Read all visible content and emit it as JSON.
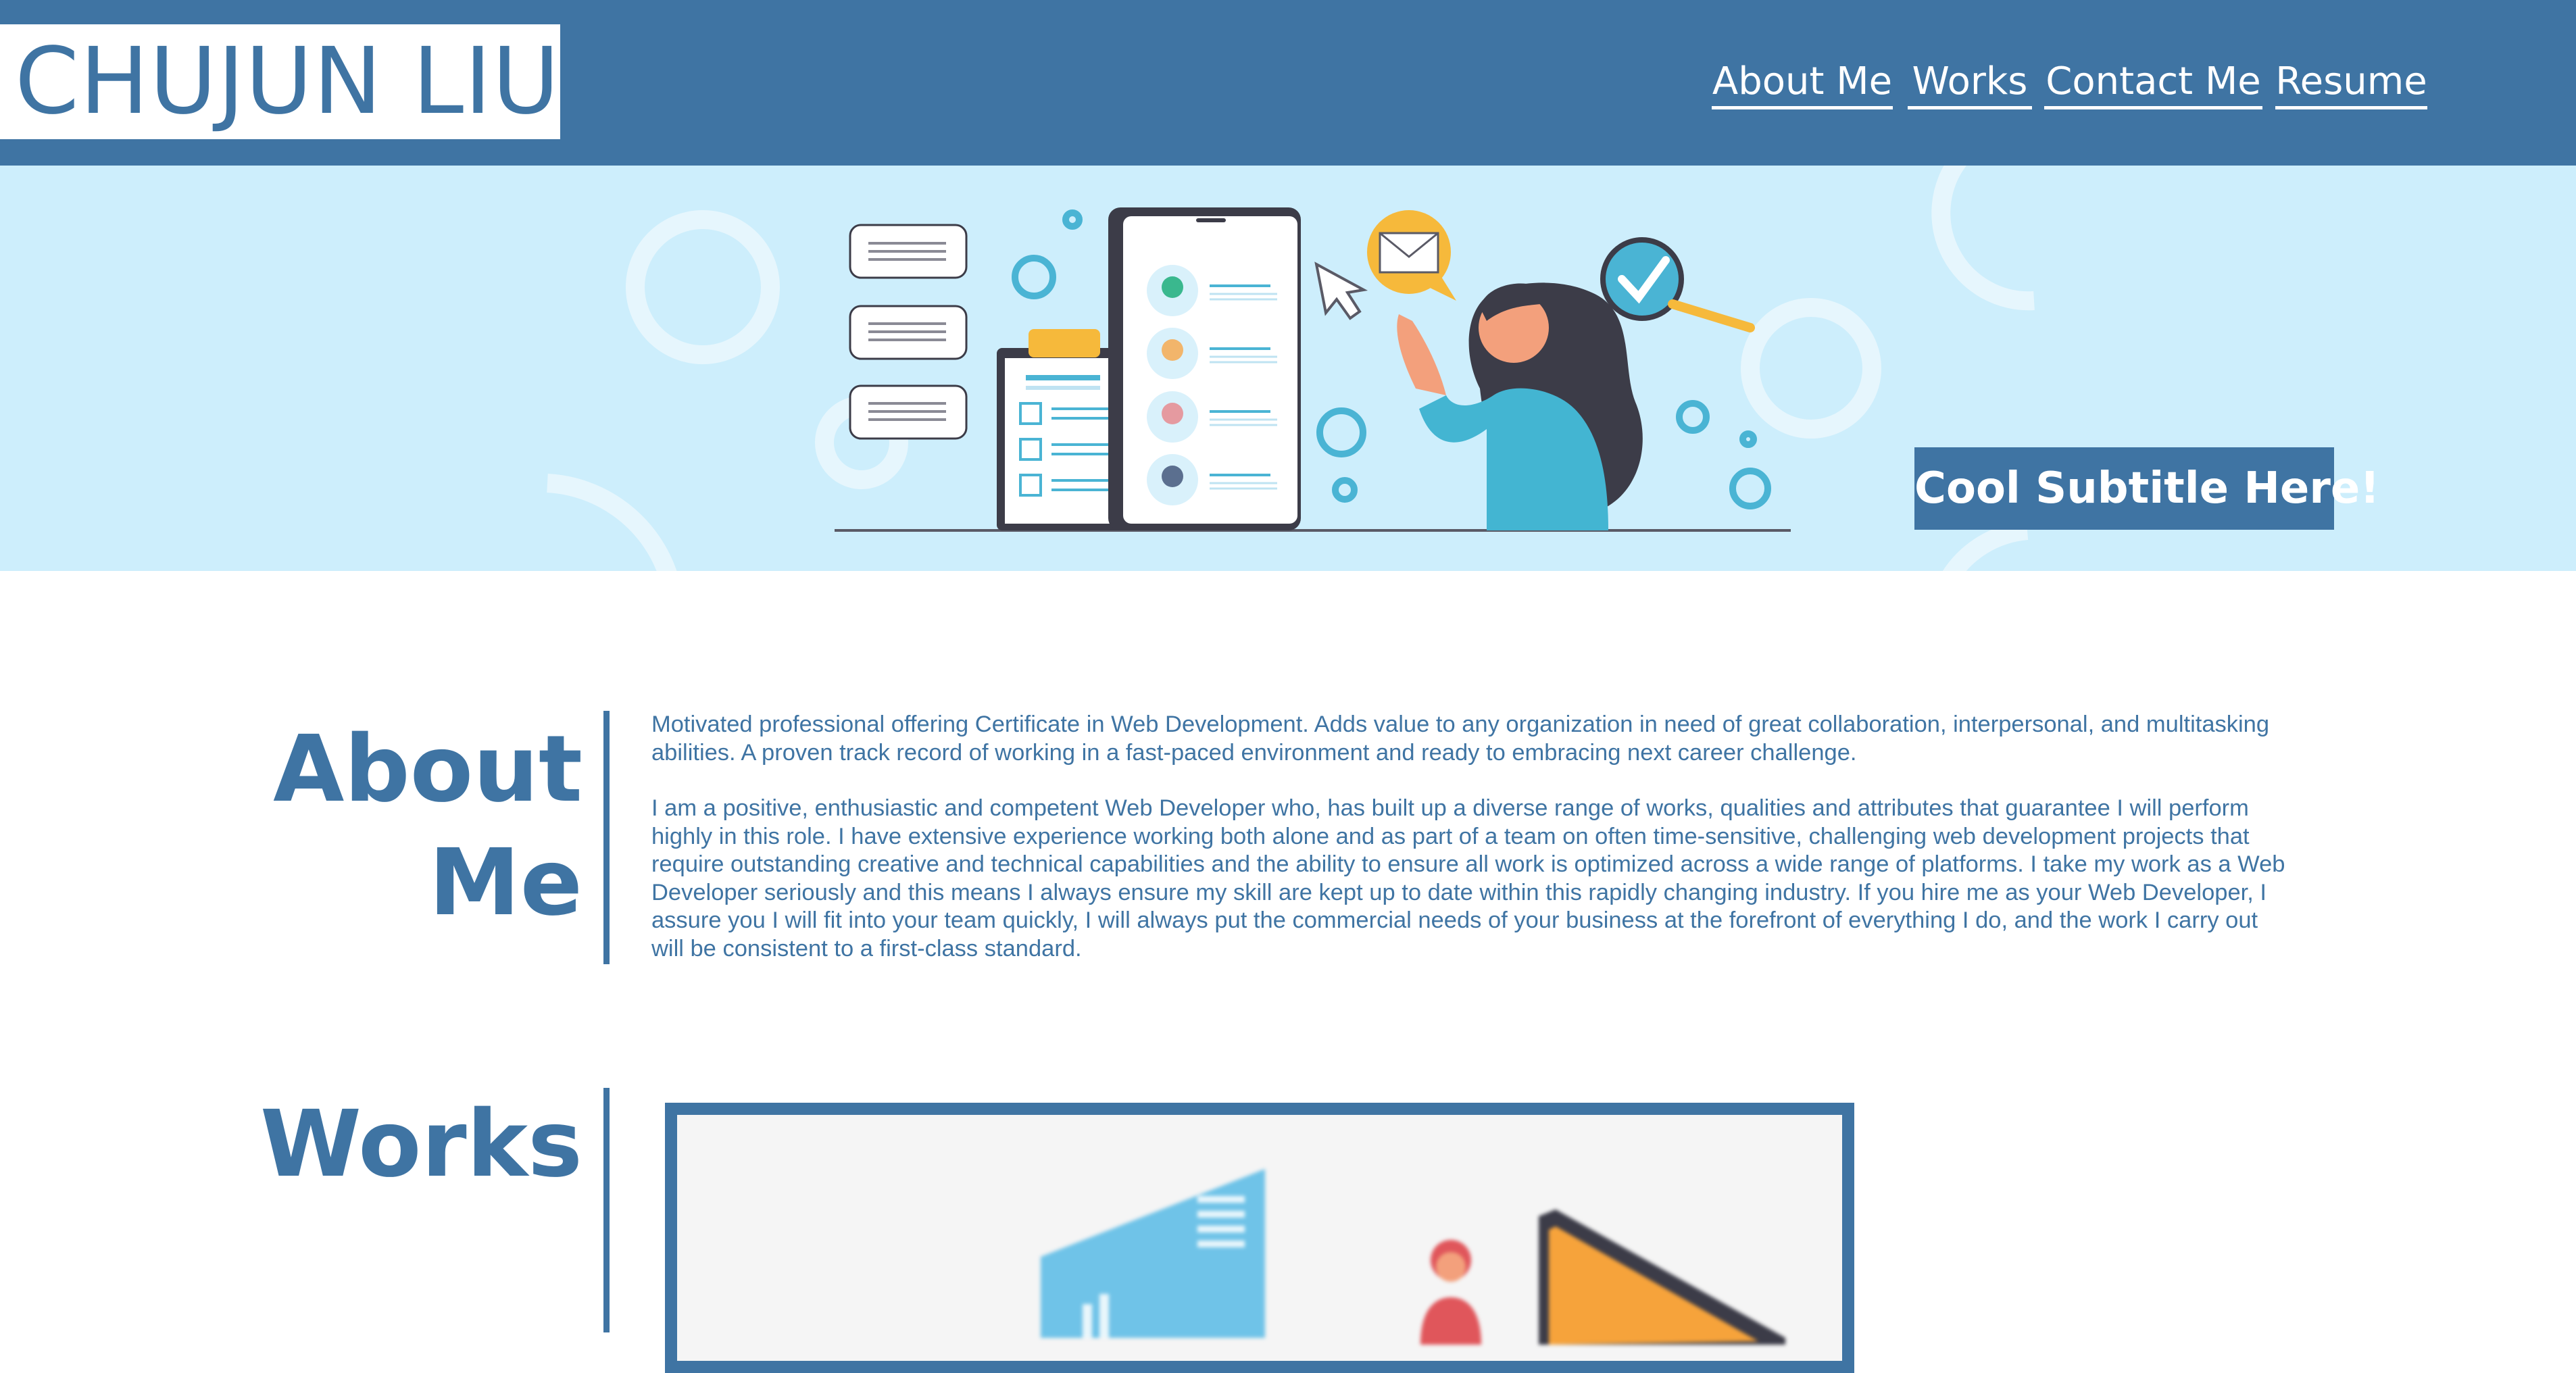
{
  "header": {
    "logo_text": "CHUJUN LIU",
    "nav": [
      {
        "label": "About Me"
      },
      {
        "label": "Works"
      },
      {
        "label": "Contact Me"
      },
      {
        "label": "Resume"
      }
    ]
  },
  "banner": {
    "subtitle": "Cool Subtitle Here!"
  },
  "about": {
    "title_line1": "About",
    "title_line2": "Me",
    "paragraphs": [
      "Motivated professional offering Certificate in Web Development. Adds value to any organization in need of great collaboration, interpersonal, and multitasking abilities. A proven track record of working in a fast-paced environment and ready to embracing next career challenge.",
      "I am a positive, enthusiastic and competent Web Developer who, has built up a diverse range of works, qualities and attributes that guarantee I will perform highly in this role. I have extensive experience working both alone and as part of a team on often time-sensitive, challenging web development projects that require outstanding creative and technical capabilities and the ability to ensure all work is optimized across a wide range of platforms. I take my work as a Web Developer seriously and this means I always ensure my skill are kept up to date within this rapidly changing industry. If you hire me as your Web Developer, I assure you I will fit into your team quickly, I will always put the commercial needs of your business at the forefront of everything I do, and the work I carry out will be consistent to a first-class standard."
    ]
  },
  "works": {
    "title": "Works"
  },
  "colors": {
    "primary": "#3f74a3",
    "banner_bg": "#cdeefc",
    "white": "#ffffff"
  }
}
